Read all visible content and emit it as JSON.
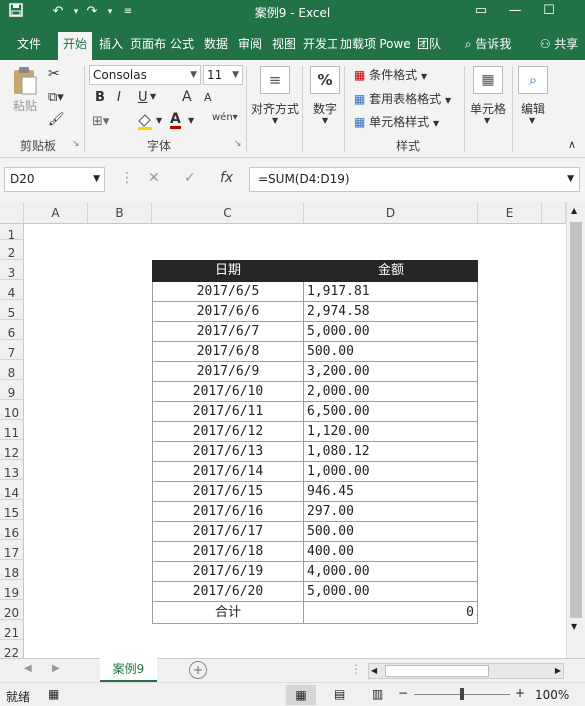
{
  "titlebar": {
    "title": "案例9 - Excel",
    "save_icon": "save-icon",
    "undo_icon": "undo-icon",
    "redo_icon": "redo-icon"
  },
  "tabs": [
    "文件",
    "开始",
    "插入",
    "页面布",
    "公式",
    "数据",
    "审阅",
    "视图",
    "开发工",
    "加载项",
    "Powe",
    "团队"
  ],
  "tabs_extra": {
    "search": "告诉我",
    "share": "共享"
  },
  "ribbon": {
    "paste_label": "粘贴",
    "clipboard_group": "剪贴板",
    "font_name": "Consolas",
    "font_size": "11",
    "bold": "B",
    "italic": "I",
    "underline": "U",
    "grow_font": "A",
    "shrink_font": "A",
    "font_group": "字体",
    "align_label": "对齐方式",
    "number_label": "数字",
    "cond_format": "条件格式",
    "table_format": "套用表格格式",
    "cell_style": "单元格样式",
    "style_group": "样式",
    "cells_label": "单元格",
    "edit_label": "编辑",
    "percent_icon": "%"
  },
  "formula_bar": {
    "name_box": "D20",
    "fx": "fx",
    "formula": "=SUM(D4:D19)"
  },
  "columns": [
    "A",
    "B",
    "C",
    "D",
    "E"
  ],
  "rows": [
    "1",
    "2",
    "3",
    "4",
    "5",
    "6",
    "7",
    "8",
    "9",
    "10",
    "11",
    "12",
    "13",
    "14",
    "15",
    "16",
    "17",
    "18",
    "19",
    "20",
    "21",
    "22"
  ],
  "table": {
    "header_date": "日期",
    "header_amount": "金额",
    "rows": [
      {
        "date": "2017/6/5",
        "amount": "1,917.81"
      },
      {
        "date": "2017/6/6",
        "amount": "2,974.58"
      },
      {
        "date": "2017/6/7",
        "amount": "5,000.00"
      },
      {
        "date": "2017/6/8",
        "amount": "500.00"
      },
      {
        "date": "2017/6/9",
        "amount": "3,200.00"
      },
      {
        "date": "2017/6/10",
        "amount": "2,000.00"
      },
      {
        "date": "2017/6/11",
        "amount": "6,500.00"
      },
      {
        "date": "2017/6/12",
        "amount": "1,120.00"
      },
      {
        "date": "2017/6/13",
        "amount": "1,080.12"
      },
      {
        "date": "2017/6/14",
        "amount": "1,000.00"
      },
      {
        "date": "2017/6/15",
        "amount": "946.45"
      },
      {
        "date": "2017/6/16",
        "amount": "297.00"
      },
      {
        "date": "2017/6/17",
        "amount": "500.00"
      },
      {
        "date": "2017/6/18",
        "amount": "400.00"
      },
      {
        "date": "2017/6/19",
        "amount": "4,000.00"
      },
      {
        "date": "2017/6/20",
        "amount": "5,000.00"
      }
    ],
    "total_label": "合计",
    "total_value": "0"
  },
  "sheet_tab": "案例9",
  "status": {
    "ready": "就绪",
    "zoom": "100%"
  },
  "colors": {
    "excel_green": "#217346",
    "table_header_bg": "#262626"
  }
}
